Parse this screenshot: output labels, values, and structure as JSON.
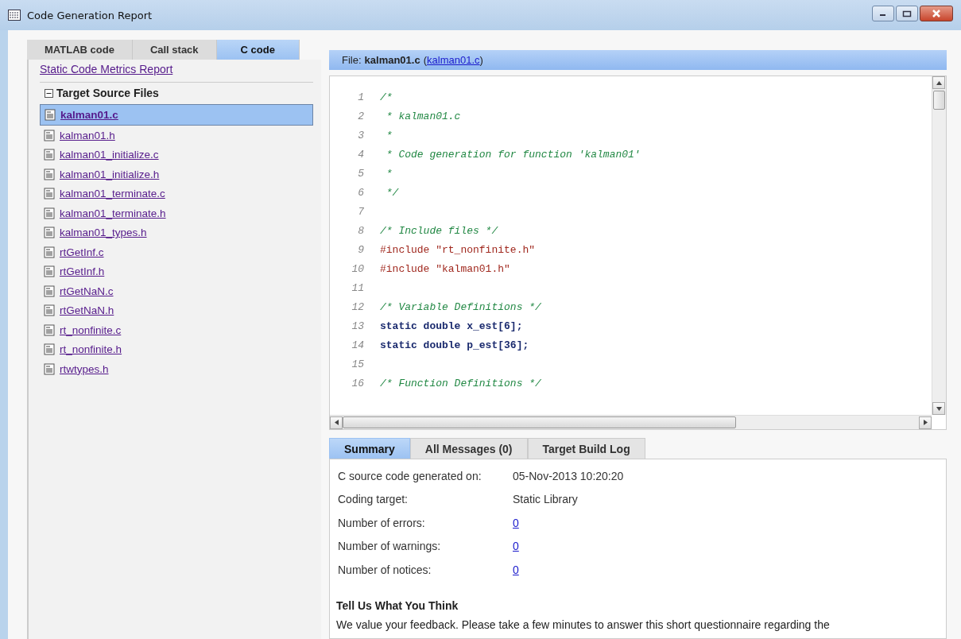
{
  "window": {
    "title": "Code Generation Report"
  },
  "left_tabs": [
    {
      "label": "MATLAB code",
      "selected": false
    },
    {
      "label": "Call stack",
      "selected": false
    },
    {
      "label": "C code",
      "selected": true
    }
  ],
  "metrics_link": "Static Code Metrics Report",
  "tree": {
    "label": "Target Source Files",
    "expanded": true,
    "children": [
      {
        "label": "kalman01.c",
        "selected": true
      },
      {
        "label": "kalman01.h",
        "selected": false
      },
      {
        "label": "kalman01_initialize.c",
        "selected": false
      },
      {
        "label": "kalman01_initialize.h",
        "selected": false
      },
      {
        "label": "kalman01_terminate.c",
        "selected": false
      },
      {
        "label": "kalman01_terminate.h",
        "selected": false
      },
      {
        "label": "kalman01_types.h",
        "selected": false
      },
      {
        "label": "rtGetInf.c",
        "selected": false
      },
      {
        "label": "rtGetInf.h",
        "selected": false
      },
      {
        "label": "rtGetNaN.c",
        "selected": false
      },
      {
        "label": "rtGetNaN.h",
        "selected": false
      },
      {
        "label": "rt_nonfinite.c",
        "selected": false
      },
      {
        "label": "rt_nonfinite.h",
        "selected": false
      },
      {
        "label": "rtwtypes.h",
        "selected": false
      }
    ]
  },
  "file_header": {
    "label": "File:",
    "name": "kalman01.c",
    "link_before": "(",
    "link": "kalman01.c",
    "link_after": ")"
  },
  "code_lines": [
    {
      "number": "1",
      "kind": "comment",
      "text": "/*"
    },
    {
      "number": "2",
      "kind": "comment",
      "text": " * kalman01.c"
    },
    {
      "number": "3",
      "kind": "comment",
      "text": " *"
    },
    {
      "number": "4",
      "kind": "comment",
      "text": " * Code generation for function 'kalman01'"
    },
    {
      "number": "5",
      "kind": "comment",
      "text": " *"
    },
    {
      "number": "6",
      "kind": "comment",
      "text": " */"
    },
    {
      "number": "7",
      "kind": "blank"
    },
    {
      "number": "8",
      "kind": "comment",
      "text": "/* Include files */"
    },
    {
      "number": "9",
      "kind": "directive",
      "text": "#include \"rt_nonfinite.h\""
    },
    {
      "number": "10",
      "kind": "directive",
      "text": "#include \"kalman01.h\""
    },
    {
      "number": "11",
      "kind": "blank"
    },
    {
      "number": "12",
      "kind": "comment",
      "text": "/* Variable Definitions */"
    },
    {
      "number": "13",
      "kind": "code",
      "text": "static double x_est[6];"
    },
    {
      "number": "14",
      "kind": "code",
      "text": "static double p_est[36];"
    },
    {
      "number": "15",
      "kind": "blank"
    },
    {
      "number": "16",
      "kind": "comment",
      "text": "/* Function Definitions */"
    }
  ],
  "bottom_tabs": [
    {
      "label": "Summary",
      "selected": true
    },
    {
      "label": "All Messages (0)",
      "selected": false
    },
    {
      "label": "Target Build Log",
      "selected": false
    }
  ],
  "summary_rows": [
    {
      "label": "C source code generated on:",
      "value": "05-Nov-2013 10:20:20",
      "kind": "text"
    },
    {
      "label": "Coding target:",
      "value": "Static Library",
      "kind": "text"
    },
    {
      "label": "Number of errors:",
      "value": "0",
      "kind": "link"
    },
    {
      "label": "Number of warnings:",
      "value": "0",
      "kind": "link"
    },
    {
      "label": "Number of notices:",
      "value": "0",
      "kind": "link"
    }
  ],
  "feedback": {
    "heading": "Tell Us What You Think",
    "text": "We value your feedback. Please take a few minutes to answer this short questionnaire regarding the"
  }
}
